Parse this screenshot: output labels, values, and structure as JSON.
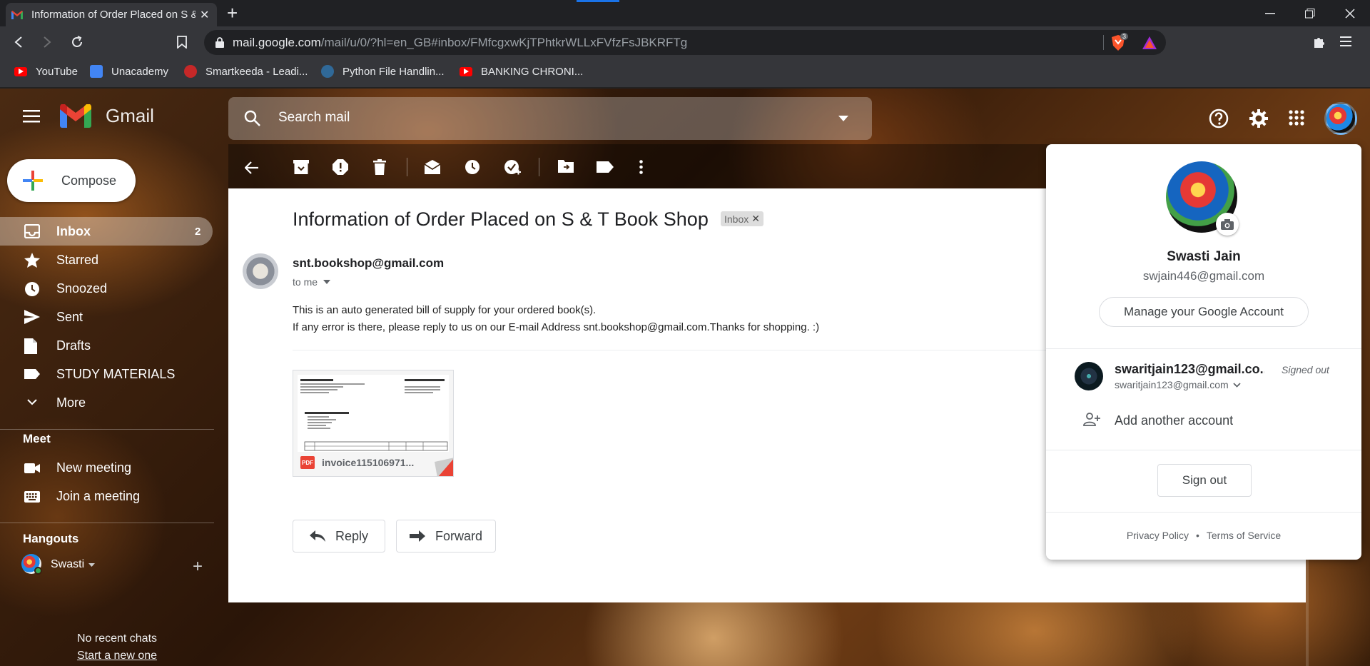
{
  "browser": {
    "tab_title": "Information of Order Placed on S & T Book Shop",
    "url_host": "mail.google.com",
    "url_path": "/mail/u/0/?hl=en_GB#inbox/FMfcgxwKjTPhtkrWLLxFVfzFsJBKRFTg",
    "brave_badge": "3",
    "bookmarks": [
      "YouTube",
      "Unacademy",
      "Smartkeeda - Leadi...",
      "Python File Handlin...",
      "BANKING CHRONI..."
    ]
  },
  "gmail": {
    "logo_text": "Gmail",
    "search_placeholder": "Search mail",
    "compose_label": "Compose",
    "nav": [
      {
        "label": "Inbox",
        "count": "2",
        "icon": "inbox-icon"
      },
      {
        "label": "Starred",
        "icon": "star-icon"
      },
      {
        "label": "Snoozed",
        "icon": "clock-icon"
      },
      {
        "label": "Sent",
        "icon": "send-icon"
      },
      {
        "label": "Drafts",
        "icon": "draft-icon"
      },
      {
        "label": "STUDY MATERIALS",
        "icon": "label-icon"
      },
      {
        "label": "More",
        "icon": "chevron-down-icon"
      }
    ],
    "meet": {
      "header": "Meet",
      "items": [
        "New meeting",
        "Join a meeting"
      ]
    },
    "hangouts": {
      "header": "Hangouts",
      "user": "Swasti",
      "no_chats": "No recent chats",
      "start_new": "Start a new one"
    }
  },
  "message": {
    "subject": "Information of Order Placed on S & T Book Shop",
    "label_chip": "Inbox",
    "sender": "snt.bookshop@gmail.com",
    "to": "to me",
    "body_line1": "This is an auto generated bill of supply for your ordered book(s).",
    "body_line2": "If any error is there, please reply to us on our E-mail Address snt.bookshop@gmail.com.Thanks for shopping. :)",
    "attachment_name": "invoice115106971...",
    "attachment_badge": "PDF",
    "reply_label": "Reply",
    "forward_label": "Forward"
  },
  "account_popup": {
    "name": "Swasti Jain",
    "email": "swjain446@gmail.com",
    "manage_label": "Manage your Google Account",
    "other_account_title": "swaritjain123@gmail.co...",
    "other_account_email": "swaritjain123@gmail.com",
    "other_account_status": "Signed out",
    "add_account_label": "Add another account",
    "sign_out_label": "Sign out",
    "privacy_label": "Privacy Policy",
    "separator": "•",
    "terms_label": "Terms of Service"
  },
  "colors": {
    "compose_bg": "#ffffff",
    "inbox_highlight": "rgba(255,255,255,0.35)",
    "gmail_red": "#ea4335",
    "gmail_blue": "#4285f4",
    "gmail_green": "#34a853",
    "gmail_yellow": "#fbbc04"
  }
}
